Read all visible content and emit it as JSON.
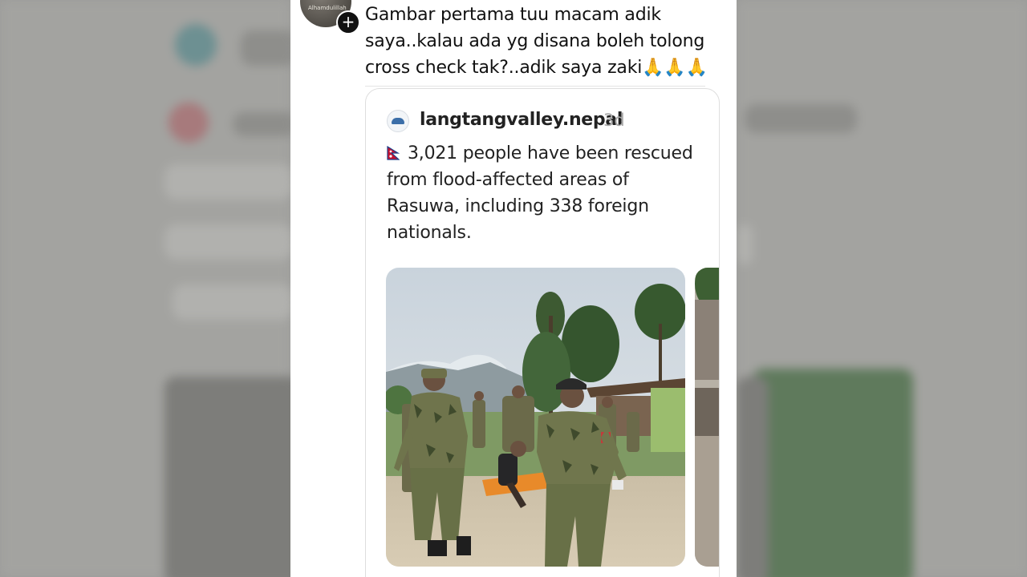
{
  "post": {
    "author_avatar_caption": "Alhamdulillah",
    "follow_symbol": "+",
    "text_lines": [
      "Gambar pertama tuu macam adik",
      "saya..kalau ada yg disana boleh tolong",
      "cross check tak?..adik saya zaki"
    ],
    "emoji": "🙏🙏🙏"
  },
  "quoted_post": {
    "username": "langtangvalley.nepal",
    "time": "3d",
    "text_lines": [
      "3,021 people have been rescued",
      "from flood-affected areas of",
      "Rasuwa, including 338 foreign",
      "nationals."
    ],
    "flag_icon": "nepal-flag-icon"
  },
  "colors": {
    "background": "#9c9c9a",
    "card": "#ffffff",
    "text": "#111111",
    "muted": "#aaaaaa"
  }
}
